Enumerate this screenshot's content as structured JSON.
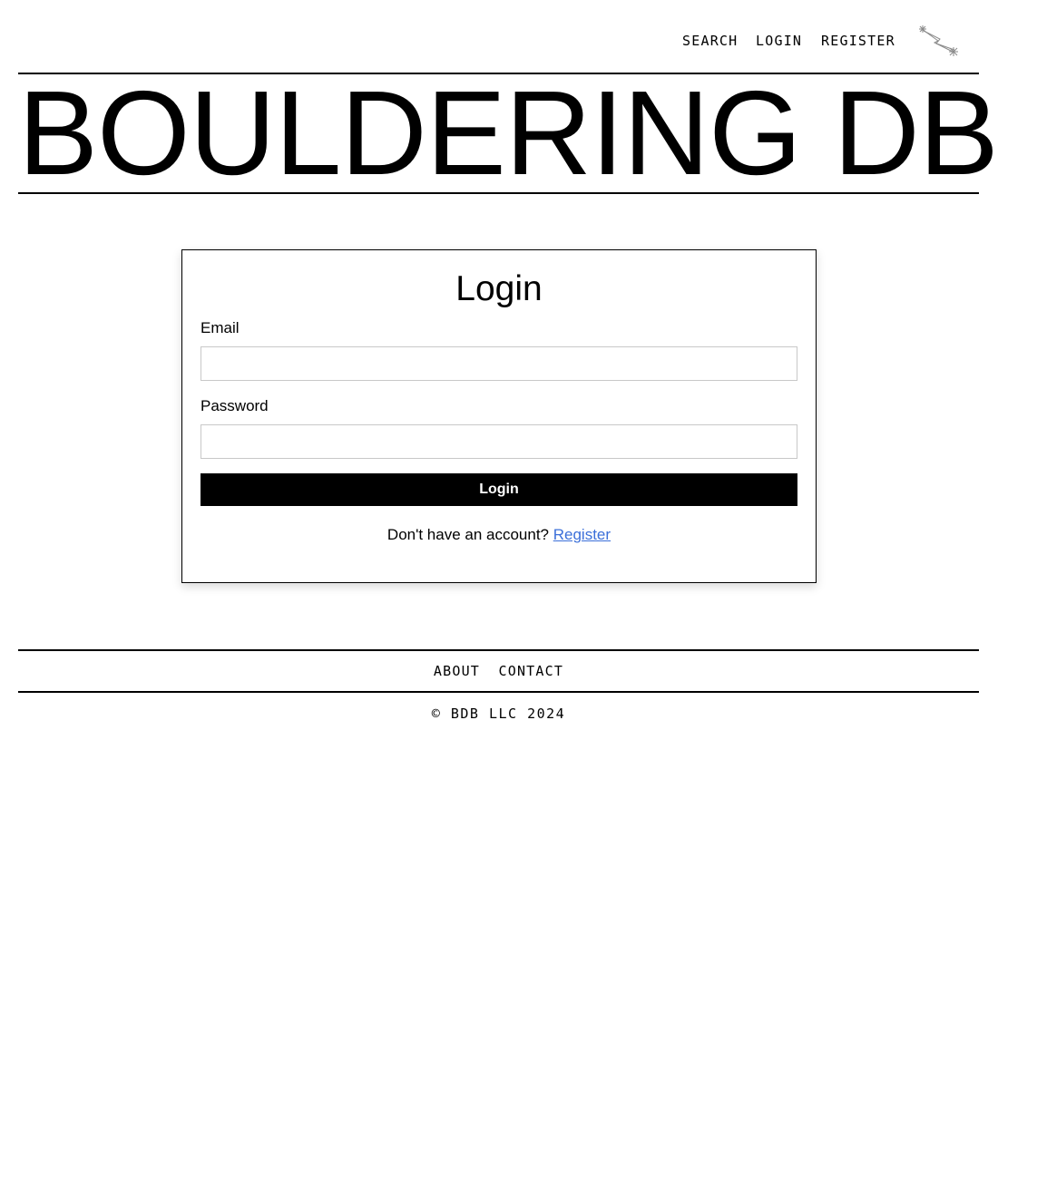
{
  "nav": {
    "search": "SEARCH",
    "login": "LOGIN",
    "register": "REGISTER",
    "logo_icon": "sparkle-climber-icon"
  },
  "header": {
    "title": "BOULDERING DB"
  },
  "login_form": {
    "title": "Login",
    "email_label": "Email",
    "email_value": "",
    "password_label": "Password",
    "password_value": "",
    "submit_label": "Login",
    "register_prompt": "Don't have an account?",
    "register_link": "Register",
    "link_color": "#3b6fd9"
  },
  "footer": {
    "about": "ABOUT",
    "contact": "CONTACT",
    "copyright": "© BDB LLC 2024"
  }
}
